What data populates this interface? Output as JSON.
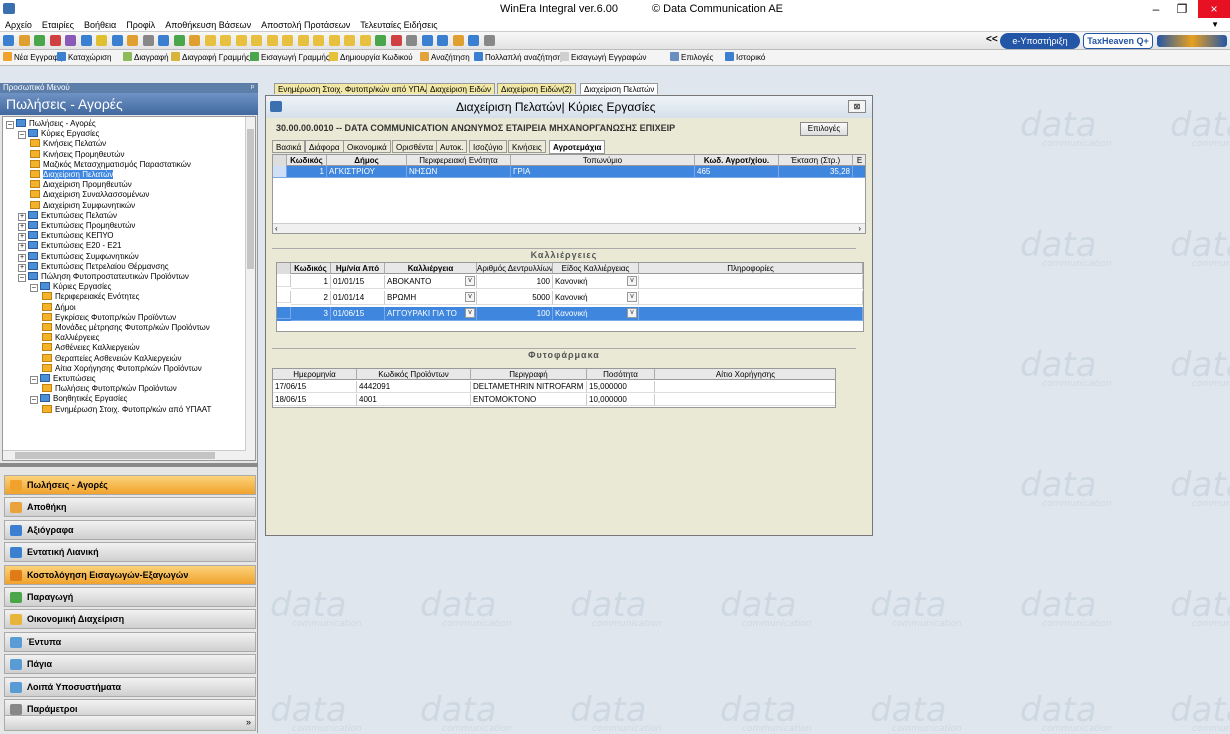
{
  "window": {
    "app_title": "WinEra Integral ver.6.00",
    "copyright": "© Data Communication AE",
    "minimize": "–",
    "maximize": "❐",
    "close": "×"
  },
  "menu": [
    "Αρχείο",
    "Εταιρίες",
    "Βοήθεια",
    "Προφίλ",
    "Αποθήκευση Βάσεων",
    "Αποστολή Προτάσεων",
    "Τελευταίες Ειδήσεις"
  ],
  "topright": {
    "nav": "<<",
    "eypost": "e-Υποστήριξη",
    "taxheaven": "TaxHeaven Q+"
  },
  "actions": [
    "Νέα Εγγραφή",
    "Καταχώριση",
    "Διαγραφή",
    "Διαγραφή Γραμμής",
    "Εισαγωγή Γραμμής",
    "Δημιουργία Κωδικού",
    "Αναζήτηση",
    "Πολλαπλή αναζήτηση",
    "Εισαγωγή Εγγραφών",
    "Επιλογές",
    "Ιστορικό"
  ],
  "sidebar": {
    "header": "Προσωπικό Μενού",
    "pin": "ᵖ",
    "title": "Πωλήσεις - Αγορές",
    "tree": [
      {
        "label": "Πωλήσεις - Αγορές",
        "level": 0,
        "pm": "–",
        "blue": true
      },
      {
        "label": "Κύριες Εργασίες",
        "level": 1,
        "pm": "–",
        "blue": true
      },
      {
        "label": "Κινήσεις Πελατών",
        "level": 2
      },
      {
        "label": "Κινήσεις Προμηθευτών",
        "level": 2
      },
      {
        "label": "Μαζικός Μετασχηματισμός Παραστατικών",
        "level": 2
      },
      {
        "label": "Διαχείριση Πελατών",
        "level": 2,
        "sel": true
      },
      {
        "label": "Διαχείριση Προμηθευτών",
        "level": 2
      },
      {
        "label": "Διαχείριση Συναλλασσομένων",
        "level": 2
      },
      {
        "label": "Διαχείριση Συμφωνητικών",
        "level": 2
      },
      {
        "label": "Εκτυπώσεις Πελατών",
        "level": 1,
        "pm": "+",
        "blue": true
      },
      {
        "label": "Εκτυπώσεις Προμηθευτών",
        "level": 1,
        "pm": "+",
        "blue": true
      },
      {
        "label": "Εκτυπώσεις ΚΕΠΥΟ",
        "level": 1,
        "pm": "+",
        "blue": true
      },
      {
        "label": "Εκτυπώσεις Ε20 - Ε21",
        "level": 1,
        "pm": "+",
        "blue": true
      },
      {
        "label": "Εκτυπώσεις Συμφωνητικών",
        "level": 1,
        "pm": "+",
        "blue": true
      },
      {
        "label": "Εκτυπώσεις Πετρελαίου Θέρμανσης",
        "level": 1,
        "pm": "+",
        "blue": true
      },
      {
        "label": "Πώληση Φυτοπροστατευτικών Προϊόντων",
        "level": 1,
        "pm": "–",
        "blue": true
      },
      {
        "label": "Κύριες Εργασίες",
        "level": 2,
        "pm": "–",
        "blue": true
      },
      {
        "label": "Περιφερειακές Ενότητες",
        "level": 3
      },
      {
        "label": "Δήμοι",
        "level": 3
      },
      {
        "label": "Εγκρίσεις Φυτοπρ/κών Προϊόντων",
        "level": 3
      },
      {
        "label": "Μονάδες μέτρησης Φυτοπρ/κών Προϊόντων",
        "level": 3
      },
      {
        "label": "Καλλιέργειες",
        "level": 3
      },
      {
        "label": "Ασθένειες Καλλιεργειών",
        "level": 3
      },
      {
        "label": "Θεραπείες Ασθενειών Καλλιεργειών",
        "level": 3
      },
      {
        "label": "Αίτια Χορήγησης Φυτοπρ/κών Προϊόντων",
        "level": 3
      },
      {
        "label": "Εκτυπώσεις",
        "level": 2,
        "pm": "–",
        "blue": true
      },
      {
        "label": "Πωλήσεις Φυτοπρ/κών Προϊόντων",
        "level": 3
      },
      {
        "label": "Βοηθητικές Εργασίες",
        "level": 2,
        "pm": "–",
        "blue": true
      },
      {
        "label": "Ενημέρωση Στοιχ. Φυτοπρ/κών από ΥΠΑΑΤ",
        "level": 3
      }
    ],
    "nav": [
      {
        "label": "Πωλήσεις - Αγορές",
        "color": "#f0a22d",
        "active": true
      },
      {
        "label": "Αποθήκη",
        "color": "#e9a33a"
      },
      {
        "label": "Αξιόγραφα",
        "color": "#3a7fd0"
      },
      {
        "label": "Εντατική Λιανική",
        "color": "#3a7fd0"
      },
      {
        "label": "Κοστολόγηση Εισαγωγών-Εξαγωγών",
        "color": "#e07c18",
        "active": true
      },
      {
        "label": "Παραγωγή",
        "color": "#4aa64a"
      },
      {
        "label": "Οικονομική Διαχείριση",
        "color": "#e8b53a"
      },
      {
        "label": "Έντυπα",
        "color": "#5b9bd5"
      },
      {
        "label": "Πάγια",
        "color": "#5b9bd5"
      },
      {
        "label": "Λοιπά Υποσυστήματα",
        "color": "#5b9bd5"
      },
      {
        "label": "Παράμετροι",
        "color": "#888888"
      }
    ]
  },
  "doc_tabs": [
    "Ενημέρωση Στοιχ. Φυτοπρ/κών από ΥΠΑΑΤ",
    "Διαχείριση Ειδών",
    "Διαχείριση Ειδών(2)",
    "Διαχείριση Πελατών"
  ],
  "watermark": {
    "big": "data",
    "small": "communication"
  },
  "dialog": {
    "title": "Διαχείριση Πελατών| Κύριες Εργασίες",
    "close": "⊠",
    "subtitle": "30.00.00.0010 -- DATA COMMUNICATION ΑΝΩΝΥΜΟΣ ΕΤΑΙΡΕΙΑ ΜΗΧΑΝΟΡΓΑΝΩΣΗΣ ΕΠΙΧΕΙΡ",
    "choose": "Επιλογές",
    "tabs": [
      "Βασικά",
      "Διάφορα",
      "Οικονομικά",
      "Ορισθέντα",
      "Αυτοκ.",
      "Ισοζύγιο",
      "Κινήσεις",
      "Αγροτεμάχια"
    ],
    "parcels": {
      "headers": [
        "Κωδικός",
        "Δήμος",
        "Περιφερειακή Ενότητα",
        "Τοπωνύμιο",
        "Κωδ. Αγροτ/χίου.",
        "Έκταση (Στρ.)",
        "Ε"
      ],
      "rows": [
        [
          "1",
          "ΑΓΚΙΣΤΡΙΟΥ",
          "ΝΗΣΩΝ",
          "ΓΡΙΑ",
          "465",
          "35,28",
          ""
        ]
      ]
    },
    "crops_title": "Καλλιέργειες",
    "crops": {
      "headers": [
        "Κωδικός",
        "Ημ/νία Από",
        "Καλλιέργεια",
        "Αριθμός Δεντρυλλίων",
        "Είδος Καλλιέργειας",
        "Πληροφορίες"
      ],
      "rows": [
        [
          "1",
          "01/01/15",
          "ΑΒΟΚΑΝΤΟ",
          "100",
          "Κανονική",
          ""
        ],
        [
          "2",
          "01/01/14",
          "ΒΡΩΜΗ",
          "5000",
          "Κανονική",
          ""
        ],
        [
          "3",
          "01/06/15",
          "ΑΓΓΟΥΡΑΚΙ ΓΙΑ ΤΟ",
          "100",
          "Κανονική",
          ""
        ]
      ]
    },
    "pesticides_title": "Φυτοφάρμακα",
    "pesticides": {
      "headers": [
        "Ημερομηνία",
        "Κωδικός Προϊόντων",
        "Περιγραφή",
        "Ποσότητα",
        "Αίτιο Χορήγησης"
      ],
      "rows": [
        [
          "17/06/15",
          "4442091",
          "DELTAMETHRIN NITROFARM",
          "15,000000",
          ""
        ],
        [
          "18/06/15",
          "4001",
          "ΕΝΤΟΜΟΚΤΟΝΟ",
          "10,000000",
          ""
        ]
      ]
    }
  }
}
